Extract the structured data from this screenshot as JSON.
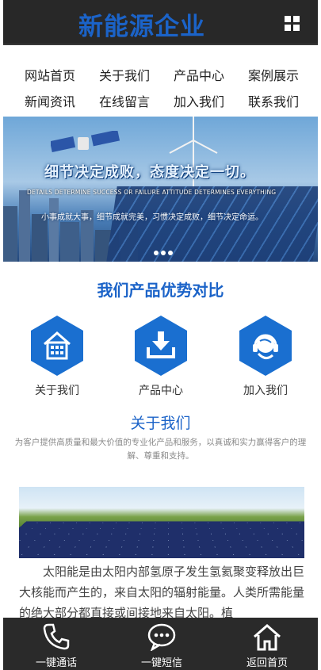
{
  "header": {
    "logo": "新能源企业",
    "menu_icon": "grid-icon"
  },
  "nav": {
    "items": [
      "网站首页",
      "关于我们",
      "产品中心",
      "案例展示",
      "新闻资讯",
      "在线留言",
      "加入我们",
      "联系我们"
    ]
  },
  "banner": {
    "title": "细节决定成败，态度决定一切。",
    "subtitle": "DETAILS DETERMINE SUCCESS OR FAILURE ATTITUDE DETERMINES EVERYTHING",
    "motto": "小事成就大事，细节成就完美，习惯决定成败，细节决定命运。"
  },
  "products": {
    "title": "我们产品优势对比",
    "features": [
      {
        "label": "关于我们",
        "icon": "building-icon"
      },
      {
        "label": "产品中心",
        "icon": "download-icon"
      },
      {
        "label": "加入我们",
        "icon": "headset-icon"
      }
    ]
  },
  "about": {
    "title": "关于我们",
    "description": "为客户提供高质量和最大价值的专业化产品和服务，以真诚和实力赢得客户的理解、尊重和支持。",
    "article": "太阳能是由太阳内部氢原子发生氢氦聚变释放出巨大核能而产生的，来自太阳的辐射能量。人类所需能量的绝大部分都直接或间接地来自太阳。植"
  },
  "bottom_bar": {
    "items": [
      {
        "label": "一键通话",
        "icon": "phone-icon"
      },
      {
        "label": "一键短信",
        "icon": "message-icon"
      },
      {
        "label": "返回首页",
        "icon": "home-icon"
      }
    ]
  },
  "colors": {
    "brand": "#1b63c8",
    "header_bg": "#282828",
    "bottom_bg": "#2a2a2a"
  }
}
